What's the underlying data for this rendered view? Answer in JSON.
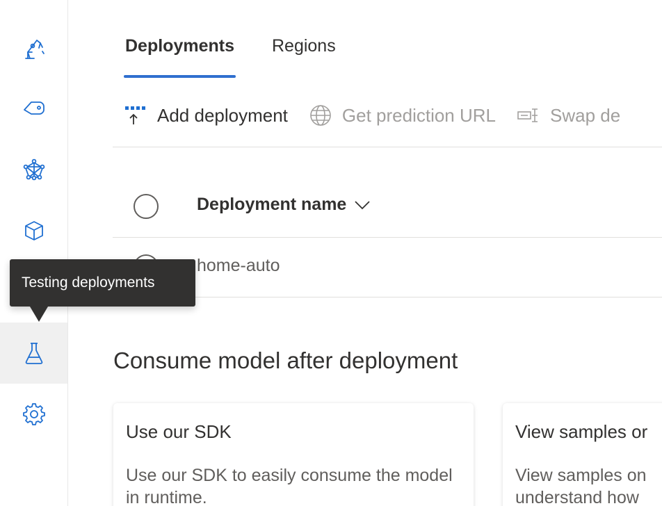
{
  "tabs": [
    {
      "label": "Deployments",
      "active": true
    },
    {
      "label": "Regions",
      "active": false
    }
  ],
  "toolbar": {
    "add_label": "Add deployment",
    "url_label": "Get prediction URL",
    "swap_label": "Swap de"
  },
  "table": {
    "header": {
      "name_col": "Deployment name"
    },
    "rows": [
      {
        "name": "home-auto"
      }
    ]
  },
  "tooltip": {
    "text": "Testing deployments"
  },
  "consume": {
    "title": "Consume model after deployment",
    "cards": [
      {
        "title": "Use our SDK",
        "desc": "Use our SDK to easily consume the model in runtime."
      },
      {
        "title": "View samples or",
        "desc": "View samples on understand how"
      }
    ]
  },
  "colors": {
    "accent": "#2f6fcf",
    "icon_blue": "#1f6fd1",
    "text_primary": "#323130",
    "text_disabled": "#a19f9d"
  }
}
